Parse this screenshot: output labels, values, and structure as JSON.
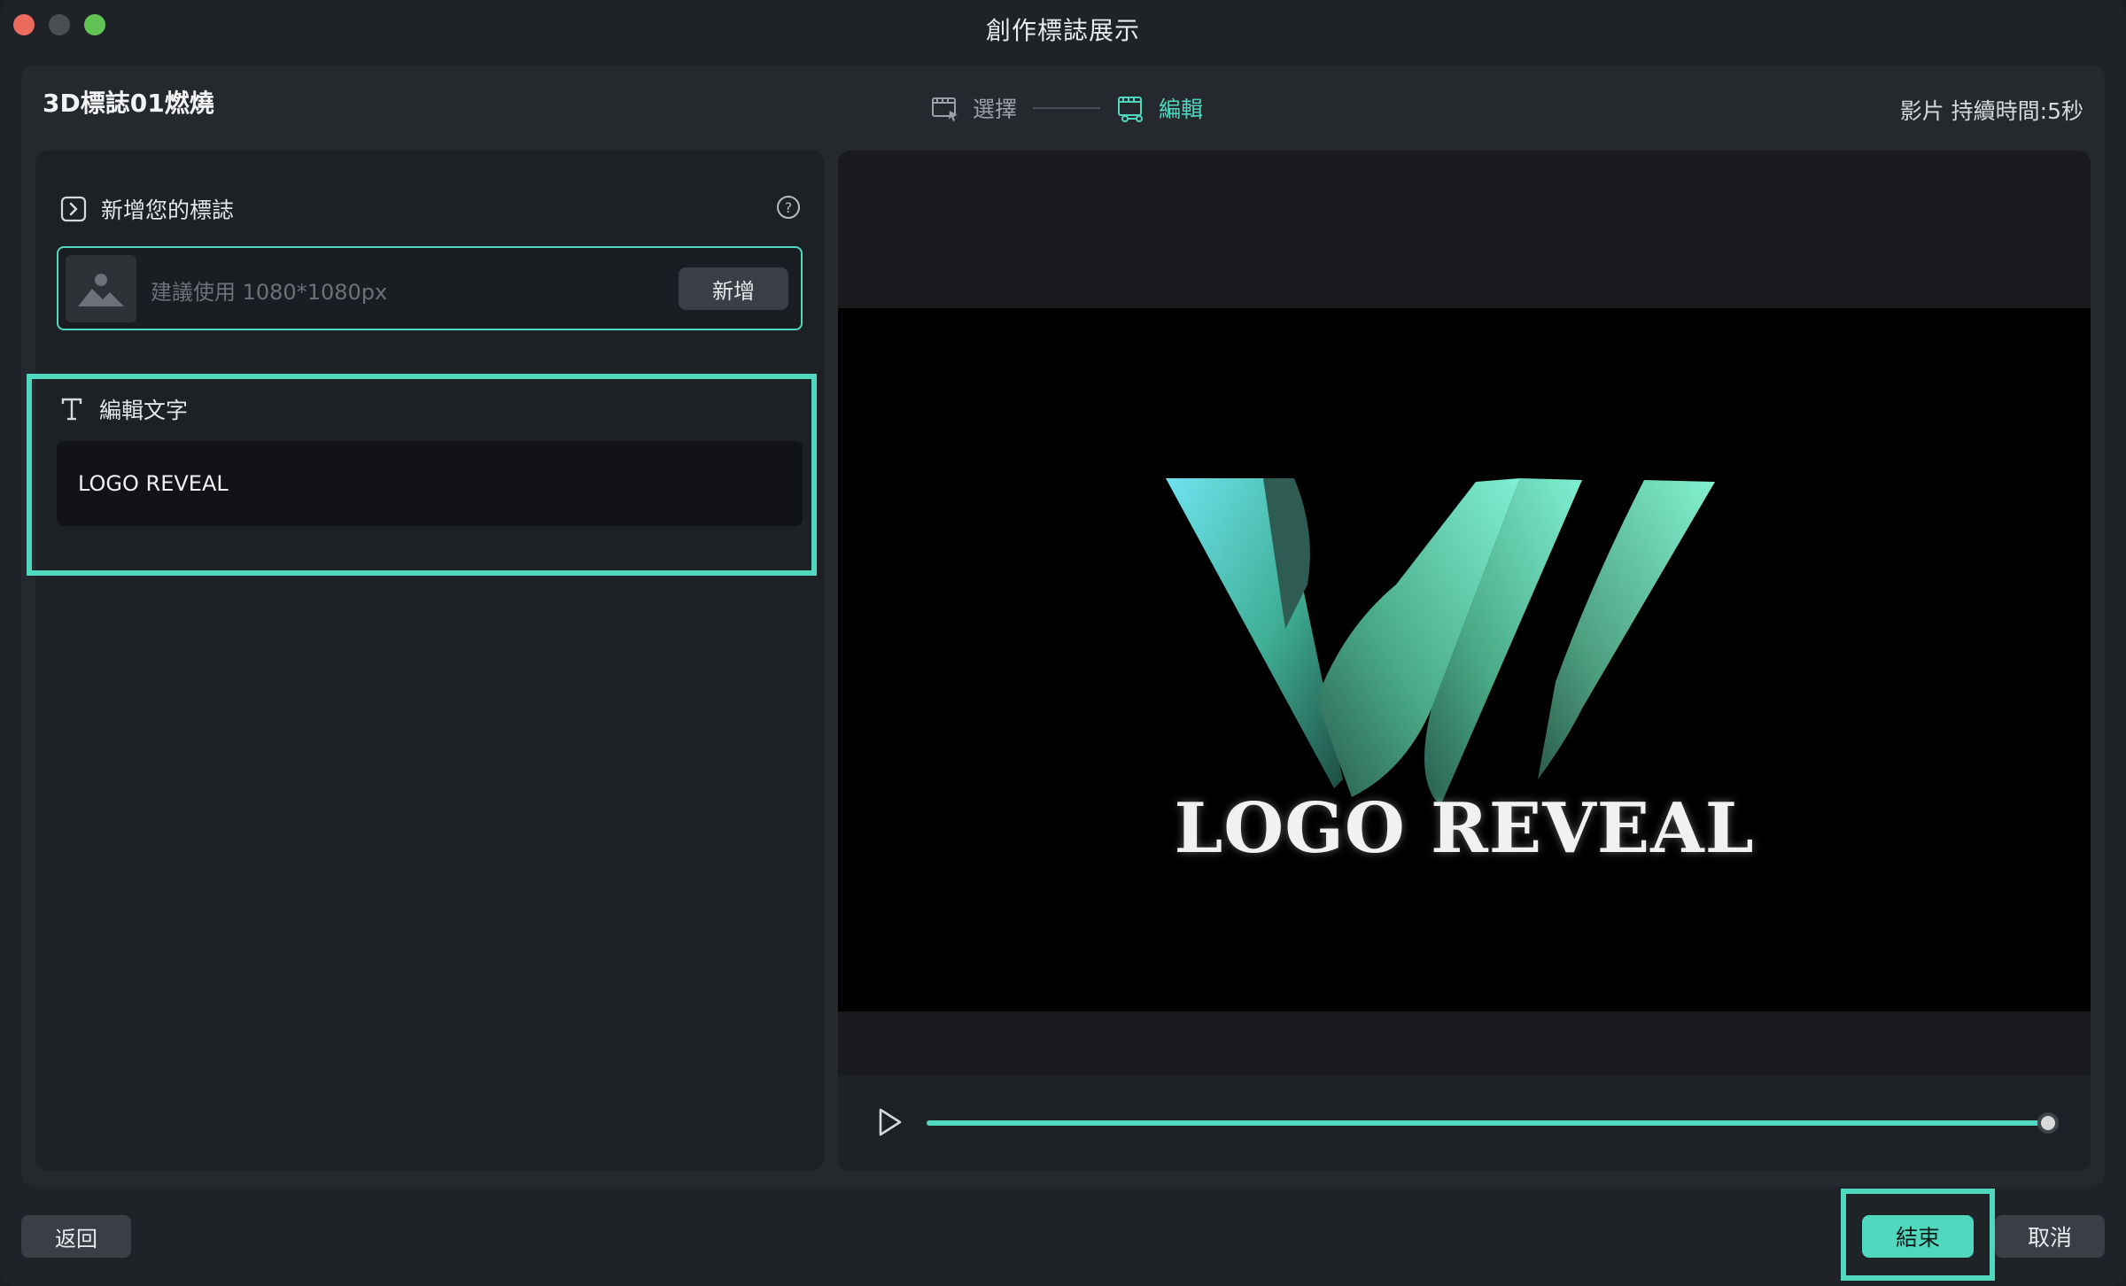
{
  "window": {
    "title": "創作標誌展示"
  },
  "header": {
    "template_title": "3D標誌01燃燒",
    "steps": [
      {
        "label": "選擇",
        "icon": "film-select-icon",
        "active": false
      },
      {
        "label": "編輯",
        "icon": "film-edit-icon",
        "active": true
      }
    ],
    "duration": "影片 持續時間:5秒"
  },
  "logo_section": {
    "title": "新增您的標誌",
    "icon": "logo-add-icon",
    "help_icon": "help-icon",
    "upload": {
      "placeholder": "建議使用 1080*1080px",
      "thumb_icon": "image-placeholder-icon",
      "add_label": "新增"
    }
  },
  "text_section": {
    "title": "編輯文字",
    "icon": "text-icon",
    "value": "LOGO REVEAL"
  },
  "preview": {
    "caption": "LOGO REVEAL",
    "play_icon": "play-icon",
    "progress": 1.0
  },
  "footer": {
    "back_label": "返回",
    "finish_label": "結束",
    "cancel_label": "取消"
  },
  "colors": {
    "accent": "#4fd8be",
    "background": "#1f2226",
    "panel": "#25292e"
  }
}
